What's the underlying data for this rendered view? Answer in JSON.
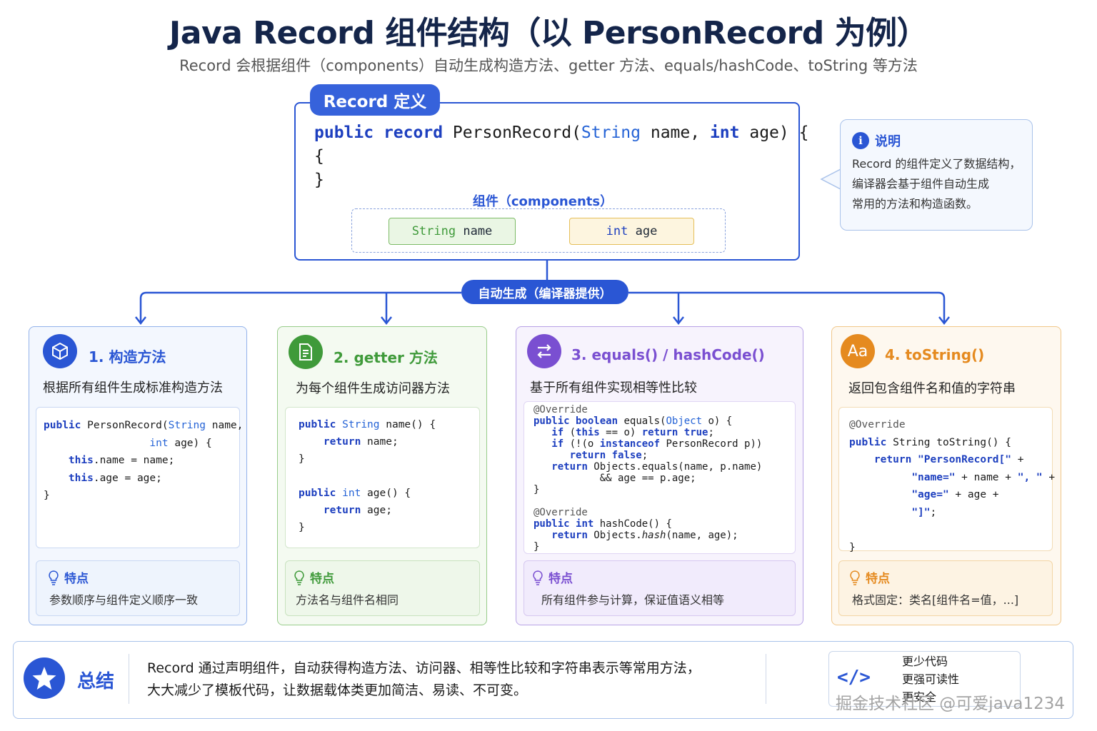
{
  "header": {
    "title": "Java Record 组件结构（以 PersonRecord 为例）",
    "subtitle": "Record 会根据组件（components）自动生成构造方法、getter 方法、equals/hashCode、toString 等方法"
  },
  "definition": {
    "tab_label": "Record 定义",
    "line1": {
      "kw1": "public",
      "kw2": "record",
      "name": "PersonRecord(",
      "type1": "String",
      "p1": " name, ",
      "type2": "int",
      "p2": " age) {"
    },
    "line2": "{",
    "line3": "}",
    "components_label": "组件（components）",
    "component1": {
      "type": "String",
      "name": " name"
    },
    "component2": {
      "type": "int",
      "name": " age"
    }
  },
  "note": {
    "title": "说明",
    "icon": "info-icon",
    "lines": [
      "Record 的组件定义了数据结构，",
      "编译器会基于组件自动生成",
      "常用的方法和构造函数。"
    ]
  },
  "auto_label": "自动生成（编译器提供）",
  "cards": [
    {
      "title": "1. 构造方法",
      "icon": "cube-icon",
      "desc": "根据所有组件生成标准构造方法",
      "feature_title": "特点",
      "feature_desc": "参数顺序与组件定义顺序一致",
      "color": "#2a56d4"
    },
    {
      "title": "2. getter 方法",
      "icon": "document-icon",
      "desc": "为每个组件生成访问器方法",
      "feature_title": "特点",
      "feature_desc": "方法名与组件名相同",
      "color": "#3f9a3a"
    },
    {
      "title": "3. equals() / hashCode()",
      "icon": "swap-icon",
      "desc": "基于所有组件实现相等性比较",
      "feature_title": "特点",
      "feature_desc": "所有组件参与计算，保证值语义相等",
      "color": "#7a4fd1"
    },
    {
      "title": "4. toString()",
      "icon": "font-icon",
      "icon_text": "Aa",
      "desc": "返回包含组件名和值的字符串",
      "feature_title": "特点",
      "feature_desc": "格式固定：类名[组件名=值，...]",
      "color": "#e58a1f"
    }
  ],
  "summary": {
    "label": "总结",
    "line1": "Record 通过声明组件，自动获得构造方法、访问器、相等性比较和字符串表示等常用方法，",
    "line2": "大大减少了模板代码，让数据载体类更加简洁、易读、不可变。",
    "code_icon": "</>",
    "benefits": [
      "更少代码",
      "更强可读性",
      "更安全"
    ]
  },
  "watermark": "掘金技术社区 @可爱java1234",
  "colors": {
    "primary": "#2a56d4",
    "green": "#3f9a3a",
    "purple": "#7a4fd1",
    "orange": "#e58a1f"
  }
}
